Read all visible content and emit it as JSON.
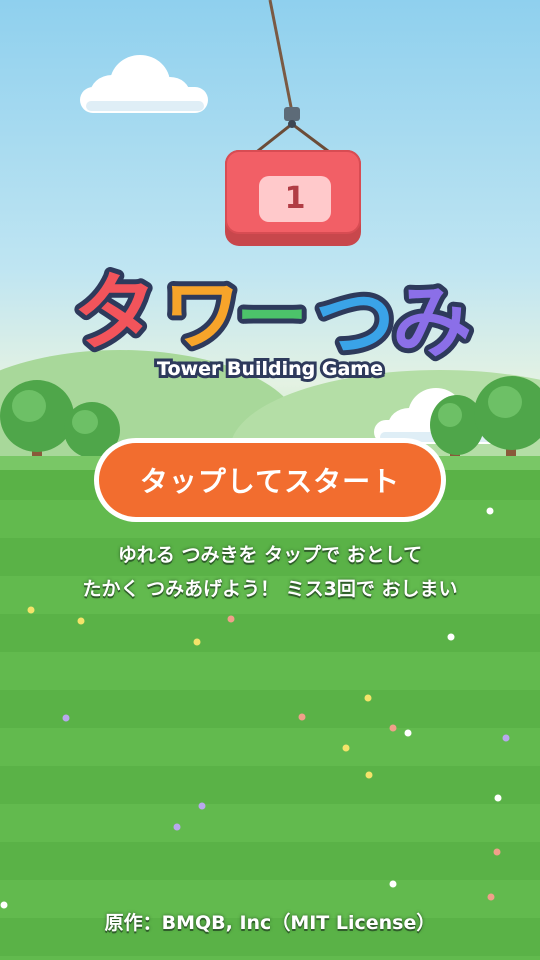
{
  "block": {
    "number": "1"
  },
  "title": {
    "chars": [
      "タ",
      "ワ",
      "ー",
      "つ",
      "み"
    ],
    "colors": [
      "#f2545b",
      "#f7a42a",
      "#4cc36a",
      "#3aa3e8",
      "#8b6fe8"
    ],
    "subtitle": "Tower Building Game"
  },
  "start_button": {
    "label": "タップしてスタート"
  },
  "instructions": {
    "line1": "ゆれる つみきを タップで おとして",
    "line2": "たかく つみあげよう！ ミス3回で おしまい"
  },
  "credit": "原作：BMQB, Inc（MIT License）",
  "colors": {
    "accent": "#f26d2f",
    "block": "#f25f66",
    "grass": "#5ab247",
    "sky": "#8fd0ee"
  }
}
